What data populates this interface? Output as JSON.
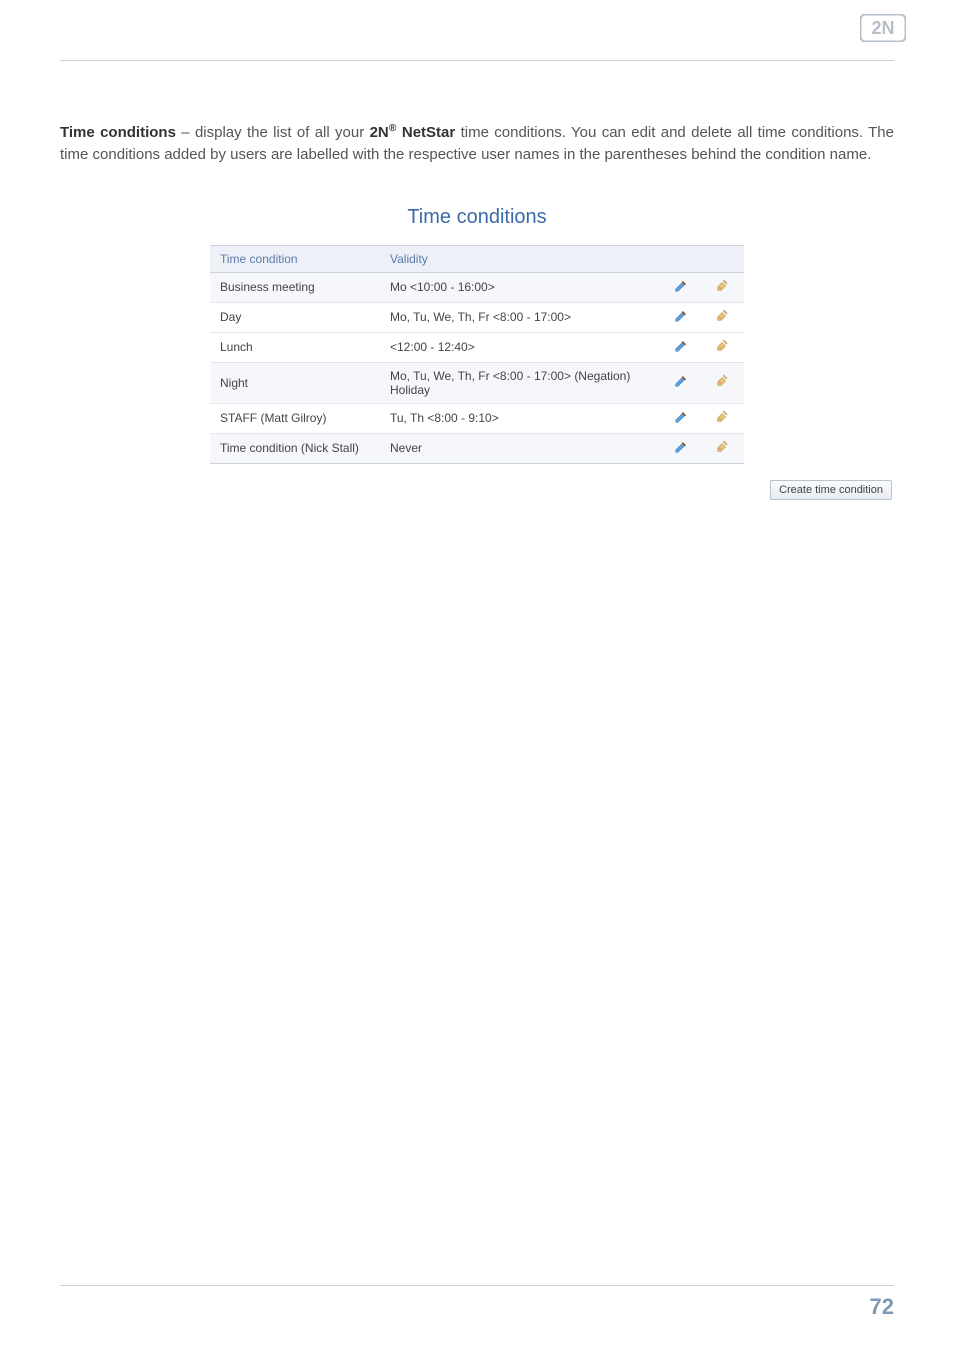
{
  "logo": {
    "name": "2N"
  },
  "body": {
    "heading_strong": "Time conditions",
    "sentence_part1": " – display the list of all your ",
    "product_strong": "2N",
    "product_sup": "®",
    "product_tail": " NetStar",
    "sentence_part2": " time conditions. You can edit and delete all time conditions. The time conditions added by users are labelled with the respective user names in the parentheses behind the condition name."
  },
  "panel": {
    "title": "Time conditions",
    "columns": {
      "name": "Time condition",
      "validity": "Validity"
    },
    "rows": [
      {
        "name": "Business meeting",
        "validity": "Mo  <10:00 - 16:00>",
        "alt": true
      },
      {
        "name": "Day",
        "validity": "Mo, Tu, We, Th, Fr  <8:00 - 17:00>",
        "alt": false
      },
      {
        "name": "Lunch",
        "validity": "<12:00 - 12:40>",
        "alt": false
      },
      {
        "name": "Night",
        "validity": "Mo, Tu, We, Th, Fr  <8:00 - 17:00>    (Negation)  Holiday",
        "alt": true
      },
      {
        "name": "STAFF (Matt Gilroy)",
        "validity": "Tu, Th  <8:00 - 9:10>",
        "alt": false
      },
      {
        "name": "Time condition (Nick Stall)",
        "validity": "Never",
        "alt": true
      }
    ],
    "create_button": "Create time condition",
    "icons": {
      "edit": "edit-icon",
      "delete": "delete-icon"
    }
  },
  "footer": {
    "page_number": "72"
  }
}
